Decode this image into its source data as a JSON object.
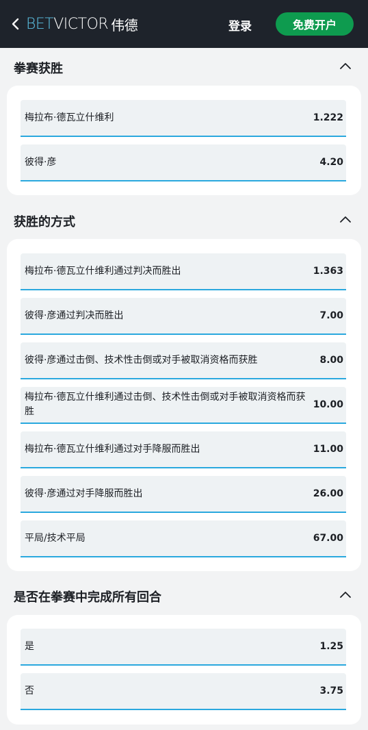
{
  "header": {
    "logo_bet": "BET",
    "logo_victor": "VICTOR",
    "logo_cn": "伟德",
    "login_label": "登录",
    "signup_label": "免费开户"
  },
  "sections": [
    {
      "title": "拳赛获胜",
      "rows": [
        {
          "name": "梅拉布·德瓦立什维利",
          "odds": "1.222"
        },
        {
          "name": "彼得·彦",
          "odds": "4.20"
        }
      ]
    },
    {
      "title": "获胜的方式",
      "rows": [
        {
          "name": "梅拉布·德瓦立什维利通过判决而胜出",
          "odds": "1.363"
        },
        {
          "name": "彼得·彦通过判决而胜出",
          "odds": "7.00"
        },
        {
          "name": "彼得·彦通过击倒、技术性击倒或对手被取消资格而获胜",
          "odds": "8.00"
        },
        {
          "name": "梅拉布·德瓦立什维利通过击倒、技术性击倒或对手被取消资格而获胜",
          "odds": "10.00"
        },
        {
          "name": "梅拉布·德瓦立什维利通过对手降服而胜出",
          "odds": "11.00"
        },
        {
          "name": "彼得·彦通过对手降服而胜出",
          "odds": "26.00"
        },
        {
          "name": "平局/技术平局",
          "odds": "67.00"
        }
      ]
    },
    {
      "title": "是否在拳赛中完成所有回合",
      "rows": [
        {
          "name": "是",
          "odds": "1.25"
        },
        {
          "name": "否",
          "odds": "3.75"
        }
      ]
    }
  ],
  "colors": {
    "header_bg": "#1e232b",
    "accent_blue": "#29a8de",
    "signup_green": "#0e9b4f",
    "row_bg": "#eef2f4"
  },
  "icons": {
    "back": "chevron-left-icon",
    "collapse": "chevron-up-icon"
  }
}
